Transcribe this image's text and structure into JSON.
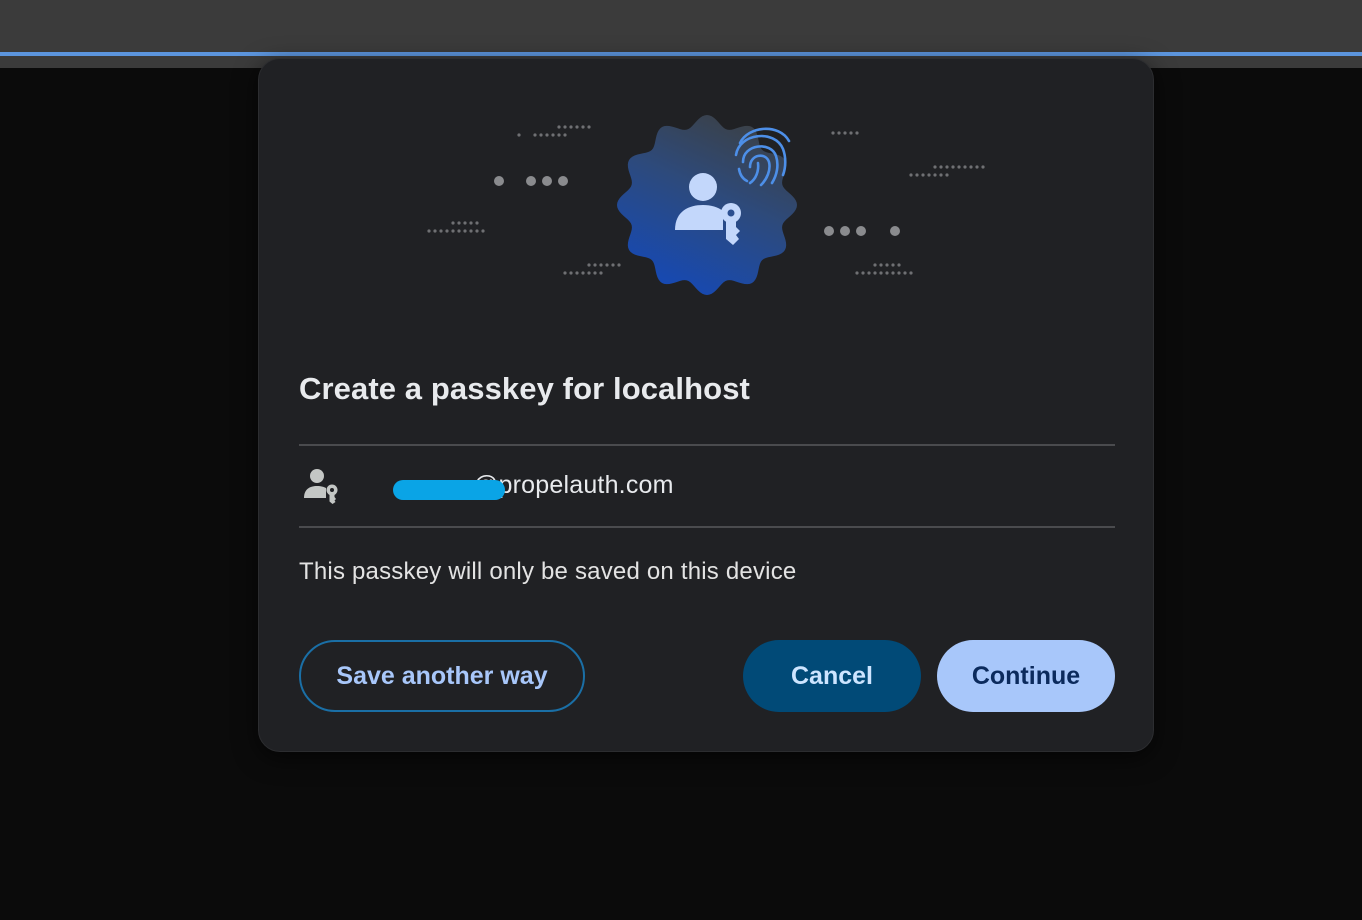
{
  "dialog": {
    "title": "Create a passkey for localhost",
    "account": {
      "email_visible": "@propelauth.com",
      "icon": "person-key-icon",
      "redacted": true
    },
    "note": "This passkey will only be saved on this device",
    "buttons": {
      "save_another_way": "Save another way",
      "cancel": "Cancel",
      "continue": "Continue"
    },
    "illustration": {
      "icons": [
        "person-key-icon",
        "fingerprint-icon"
      ],
      "badge_gradient": [
        "#3c4043",
        "#1a4fb5"
      ],
      "accent_color": "#4d8fe8"
    }
  },
  "colors": {
    "dialog_bg": "#202124",
    "primary_button": "#a8c7fa",
    "cancel_button": "#014a77",
    "outline_button_border": "#1a6fa6",
    "redaction": "#0aa4e6",
    "focus_line": "#5c95dd"
  }
}
